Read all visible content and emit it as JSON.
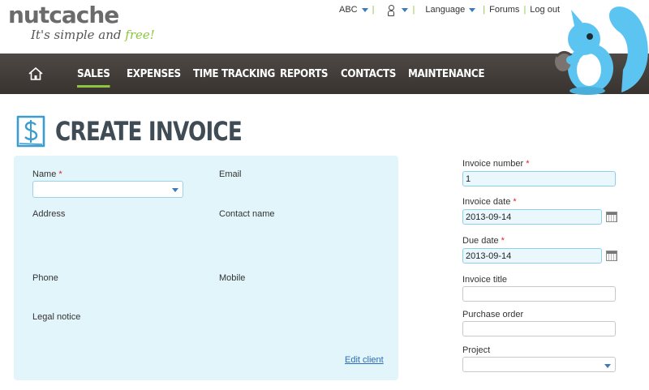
{
  "brand": {
    "name": "nutcache",
    "tagline_main": "It's simple and ",
    "tagline_accent": "free!"
  },
  "toplinks": {
    "account": "ABC",
    "language": "Language",
    "forums": "Forums",
    "logout": "Log out"
  },
  "nav": {
    "home_icon": "home-icon",
    "items": [
      "SALES",
      "EXPENSES",
      "TIME TRACKING",
      "REPORTS",
      "CONTACTS",
      "MAINTENANCE"
    ],
    "active": "SALES"
  },
  "page": {
    "title": "CREATE INVOICE",
    "icon": "invoice-dollar-icon"
  },
  "client": {
    "name_label": "Name",
    "name_value": "",
    "email_label": "Email",
    "address_label": "Address",
    "contact_label": "Contact name",
    "phone_label": "Phone",
    "mobile_label": "Mobile",
    "legal_label": "Legal notice",
    "edit_link": "Edit client"
  },
  "invoice": {
    "number_label": "Invoice number",
    "number_value": "1",
    "date_label": "Invoice date",
    "date_value": "2013-09-14",
    "due_label": "Due date",
    "due_value": "2013-09-14",
    "title_label": "Invoice title",
    "title_value": "",
    "po_label": "Purchase order",
    "po_value": "",
    "project_label": "Project",
    "project_value": ""
  },
  "required_mark": "*",
  "colors": {
    "nav_bg": "#3f3a36",
    "accent_green": "#8cc63f",
    "panel_bg": "#e2f5fb",
    "link_blue": "#2a6db8",
    "required_red": "#d9232d",
    "squirrel_blue": "#5bc4f1"
  }
}
